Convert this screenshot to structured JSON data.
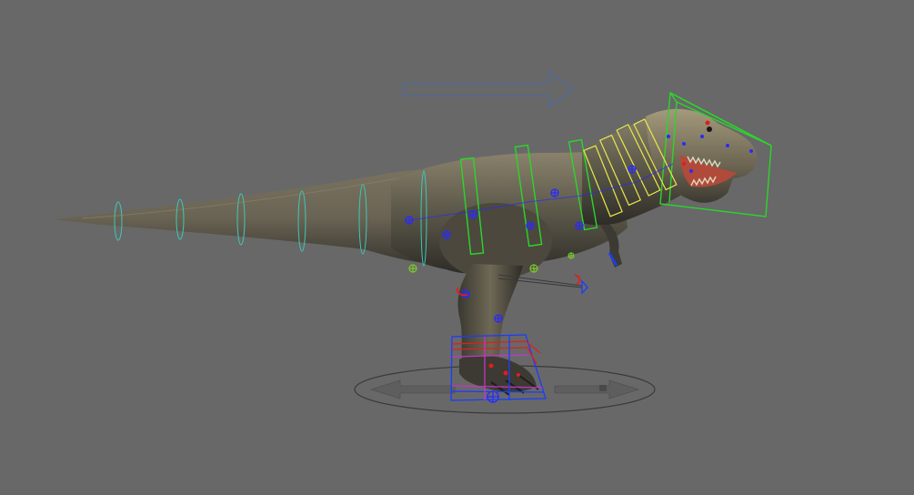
{
  "viewport": {
    "background": "#686868",
    "subject": "t-rex-model"
  },
  "colors": {
    "body_dark": "#3c3a33",
    "body_mid": "#5f5b4c",
    "body_light": "#8a826c",
    "head_light": "#a49a7c",
    "teeth": "#e0d8c0",
    "mouth": "#b04a3a",
    "spine_control": "#3ec8b8",
    "neck_control": "#2bd62b",
    "head_control": "#e8e84a",
    "joint": "#2a2aff",
    "ik_red": "#e01e1e",
    "ik_blue": "#1a3cff",
    "ik_magenta": "#c436c4",
    "ground_ring": "#3a3a3a",
    "direction_arrow": "#4e6a9c"
  },
  "icons": {
    "direction": "direction-arrow-icon",
    "root": "root-circle-icon",
    "joint": "joint-crosshair-icon",
    "pole": "pole-vector-icon"
  }
}
